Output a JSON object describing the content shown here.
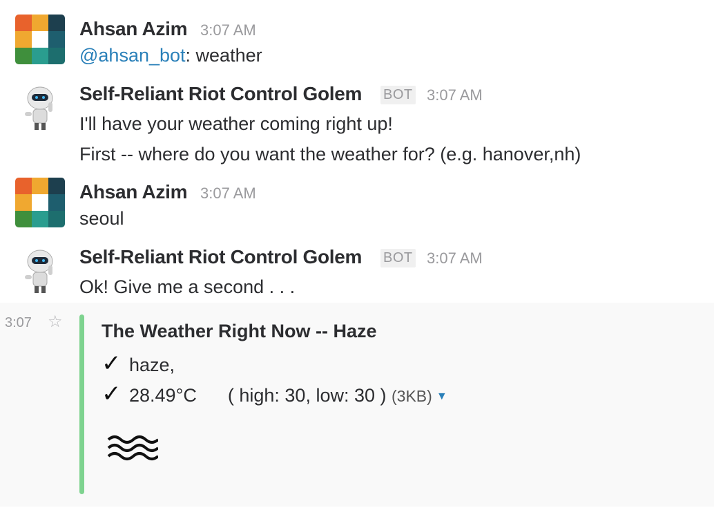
{
  "messages": [
    {
      "author": "Ahsan Azim",
      "time": "3:07 AM",
      "mention": "@ahsan_bot",
      "text": ": weather"
    },
    {
      "author": "Self-Reliant Riot Control Golem",
      "badge": "BOT",
      "time": "3:07 AM",
      "lines": [
        "I'll have your weather coming right up!",
        "First -- where do you want the weather for? (e.g. hanover,nh)"
      ]
    },
    {
      "author": "Ahsan Azim",
      "time": "3:07 AM",
      "text": "seoul"
    },
    {
      "author": "Self-Reliant Riot Control Golem",
      "badge": "BOT",
      "time": "3:07 AM",
      "text": "Ok! Give me a second . . ."
    }
  ],
  "attachment": {
    "hover_time": "3:07",
    "title": "The Weather Right Now -- Haze",
    "line1": "haze,",
    "line2": "28.49°C      ( high: 30, low: 30 )",
    "size": "(3KB)",
    "check_symbol": "✓",
    "star_symbol": "☆",
    "caret_symbol": "▼",
    "icon": "haze-icon",
    "bar_color": "#7ed38f"
  }
}
